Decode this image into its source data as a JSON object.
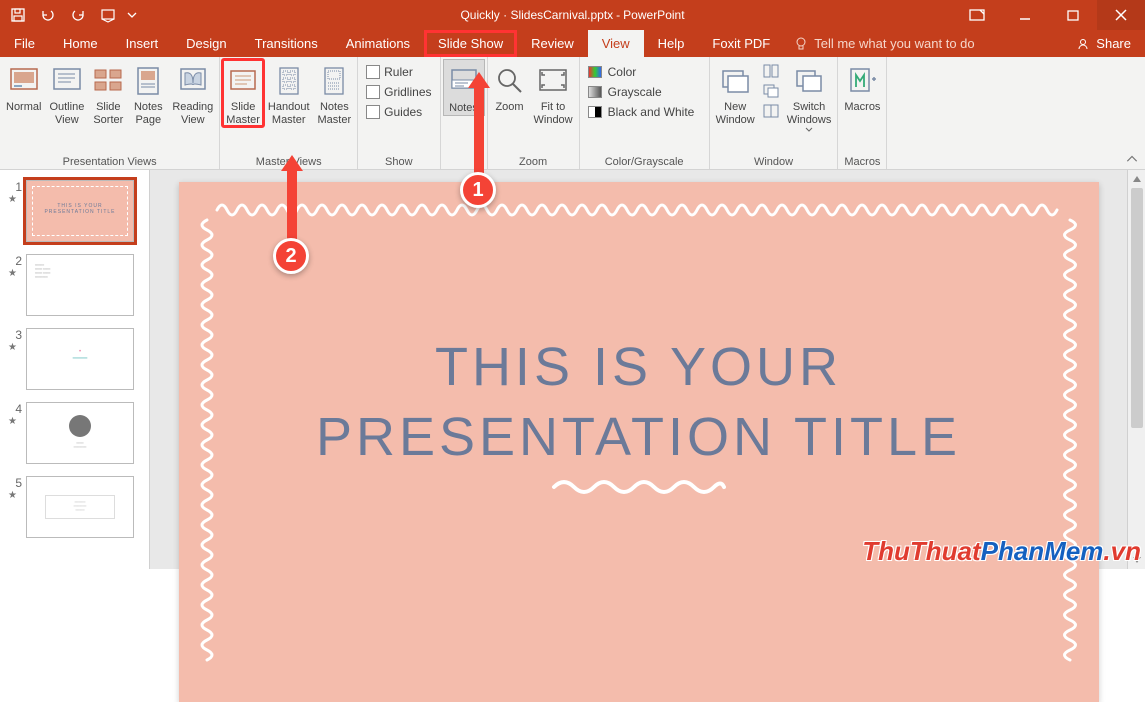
{
  "title": {
    "doc": "Quickly · SlidesCarnival.pptx",
    "sep": "  -  ",
    "app": "PowerPoint"
  },
  "tabs": {
    "file": "File",
    "home": "Home",
    "insert": "Insert",
    "design": "Design",
    "transitions": "Transitions",
    "animations": "Animations",
    "slideshow": "Slide Show",
    "review": "Review",
    "view": "View",
    "help": "Help",
    "foxit": "Foxit PDF"
  },
  "tellme": "Tell me what you want to do",
  "share": "Share",
  "ribbon": {
    "presentation_views": {
      "label": "Presentation Views",
      "normal": "Normal",
      "outline": "Outline\nView",
      "sorter": "Slide\nSorter",
      "notespage": "Notes\nPage",
      "reading": "Reading\nView"
    },
    "master_views": {
      "label": "Master Views",
      "slidemaster": "Slide\nMaster",
      "handout": "Handout\nMaster",
      "notesmaster": "Notes\nMaster"
    },
    "show": {
      "label": "Show",
      "ruler": "Ruler",
      "gridlines": "Gridlines",
      "guides": "Guides"
    },
    "notes": "Notes",
    "zoom": {
      "label": "Zoom",
      "zoom": "Zoom",
      "fit": "Fit to\nWindow"
    },
    "colorgray": {
      "label": "Color/Grayscale",
      "color": "Color",
      "gray": "Grayscale",
      "bw": "Black and White"
    },
    "window": {
      "label": "Window",
      "new": "New\nWindow",
      "switch": "Switch\nWindows"
    },
    "macros": {
      "label": "Macros",
      "macros": "Macros"
    }
  },
  "thumbs": [
    {
      "n": "1"
    },
    {
      "n": "2"
    },
    {
      "n": "3"
    },
    {
      "n": "4"
    },
    {
      "n": "5"
    }
  ],
  "slide": {
    "line1": "This is your",
    "line2": "presentation title"
  },
  "annotations": {
    "a1": "1",
    "a2": "2"
  },
  "watermark": {
    "t1": "ThuThuat",
    "t2": "PhanMem",
    "t3": ".vn"
  }
}
